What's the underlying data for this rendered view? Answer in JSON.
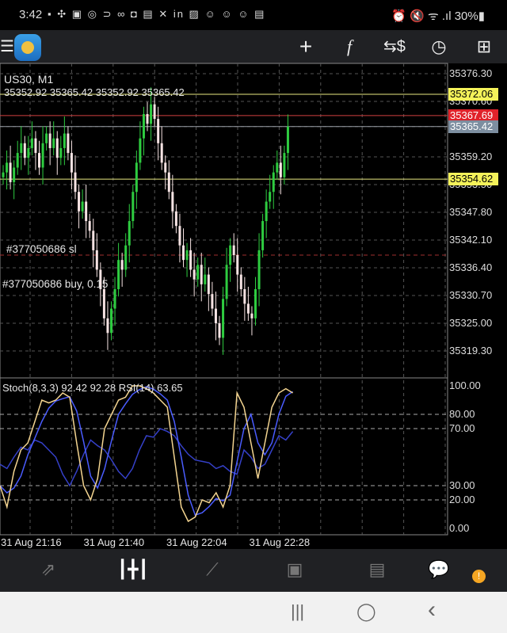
{
  "status_bar": {
    "time": "3:42",
    "notif_icons": "▪ ✣ ▣ ◎ ⊃ ∞ ◘ ▤ ✕ in ▨ ☺ ☺ ☺ ▤",
    "right": "⏰ 🔇 ᯤ .ıl 30%▮"
  },
  "toolbar": {
    "icons": [
      "menu-icon",
      "app-logo",
      "crosshair-icon",
      "indicators-icon",
      "trade-icon",
      "timeframe-icon",
      "new-order-icon"
    ]
  },
  "chart": {
    "symbol": "US30, M1",
    "ohlc": "35352.92 35365.42 35352.92 35365.42",
    "order_sl": "#377050686 sl",
    "order_buy": "#377050686 buy, 0.15",
    "price_levels": [
      "35376.30",
      "35370.60",
      "35365.42",
      "35359.20",
      "35353.50",
      "35347.80",
      "35342.10",
      "35336.40",
      "35330.70",
      "35325.00",
      "35319.30"
    ],
    "tags": [
      {
        "value": "35372.06",
        "color": "#f4f25a",
        "text": "#000"
      },
      {
        "value": "35367.69",
        "color": "#e0222a",
        "text": "#fff"
      },
      {
        "value": "35365.42",
        "color": "#7d8ea0",
        "text": "#fff"
      },
      {
        "value": "35354.62",
        "color": "#f4f25a",
        "text": "#000"
      }
    ],
    "line_colors": {
      "yellow": "#e8e880",
      "red": "#d04040",
      "gray": "#9aa0a8",
      "bull": "#2ecc40",
      "bear": "#f6e3e3"
    }
  },
  "indicator": {
    "header": "Stoch(8,3,3) 92.42 92.28 RSI(14) 63.65",
    "levels": [
      "100.00",
      "80.00",
      "70.00",
      "30.00",
      "20.00",
      "0.00"
    ]
  },
  "time_axis": [
    "31 Aug 21:16",
    "31 Aug 21:40",
    "31 Aug 22:04",
    "31 Aug 22:28"
  ],
  "chart_data": {
    "type": "candlestick",
    "closes": [
      35356,
      35358,
      35354,
      35357,
      35360,
      35362,
      35359,
      35361,
      35363,
      35360,
      35357,
      35362,
      35364,
      35361,
      35363,
      35359,
      35361,
      35364,
      35360,
      35356,
      35352,
      35348,
      35350,
      35346,
      35344,
      35340,
      35336,
      35332,
      35326,
      35323,
      35328,
      35332,
      35338,
      35336,
      35341,
      35346,
      35352,
      35358,
      35363,
      35368,
      35366,
      35370,
      35367,
      35362,
      35358,
      35356,
      35352,
      35348,
      35345,
      35341,
      35338,
      35340,
      35336,
      35334,
      35337,
      35333,
      35335,
      35331,
      35328,
      35325,
      35322,
      35330,
      35337,
      35341,
      35339,
      35335,
      35332,
      35329,
      35327,
      35326,
      35332,
      35340,
      35346,
      35350,
      35352,
      35356,
      35358,
      35355,
      35360,
      35365.42
    ],
    "stoch_k": [
      30,
      15,
      40,
      55,
      60,
      75,
      90,
      88,
      90,
      95,
      92,
      60,
      30,
      20,
      35,
      70,
      80,
      90,
      92,
      100,
      100,
      98,
      95,
      90,
      85,
      50,
      15,
      5,
      8,
      20,
      18,
      25,
      15,
      30,
      95,
      85,
      60,
      35,
      60,
      85,
      95,
      98,
      95
    ],
    "rsi": [
      45,
      42,
      50,
      57,
      55,
      62,
      60,
      55,
      50,
      38,
      30,
      40,
      52,
      62,
      58,
      55,
      48,
      40,
      35,
      42,
      55,
      65,
      64,
      70,
      68,
      65,
      58,
      52,
      48,
      47,
      46,
      42,
      44,
      40,
      38,
      55,
      50,
      42,
      45,
      55,
      65,
      62,
      68
    ],
    "price_range": [
      35316,
      35380
    ],
    "indicator_range": [
      0,
      100
    ]
  },
  "bottom_nav": [
    "quotes-tab",
    "chart-tab",
    "trade-tab",
    "history-tab",
    "news-tab",
    "chat-tab"
  ],
  "nav_badge": "!",
  "system_nav": {
    "recents": "|||",
    "home": "◯",
    "back": "‹"
  }
}
